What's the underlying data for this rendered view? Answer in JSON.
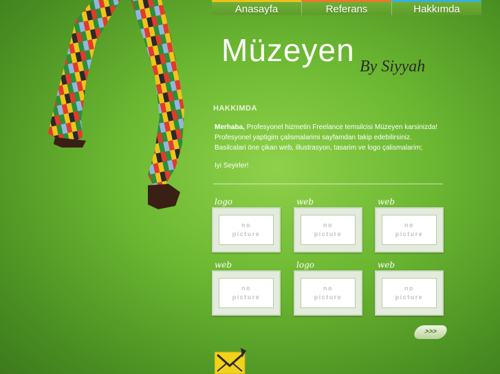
{
  "nav": {
    "items": [
      {
        "label": "Anasayfa",
        "color": "#f0c01a"
      },
      {
        "label": "Referans",
        "color": "#e87a2a"
      },
      {
        "label": "Hakkımda",
        "color": "#3ab0d8"
      }
    ]
  },
  "header": {
    "title": "Müzeyen",
    "byline": "By Siyyah"
  },
  "about": {
    "section_title": "HAKKIMDA",
    "greeting": "Merhaba,",
    "line1": " Profesyonel hizmetin Freelance temsilcisi Müzeyen karsinizda!",
    "line2": "Profesyonel yaptigim çalismalarimi sayfamdan takip edebilirsiniz.",
    "line3": "Basilcalari öne çikan web, illustrasyon, tasarim ve logo çalismalarim;",
    "closing": "Iyi Seyirler!"
  },
  "portfolio": {
    "items": [
      {
        "label": "logo",
        "placeholder_top": "no",
        "placeholder_bottom": "picture"
      },
      {
        "label": "web",
        "placeholder_top": "no",
        "placeholder_bottom": "picture"
      },
      {
        "label": "web",
        "placeholder_top": "no",
        "placeholder_bottom": "picture"
      },
      {
        "label": "web",
        "placeholder_top": "no",
        "placeholder_bottom": "picture"
      },
      {
        "label": "logo",
        "placeholder_top": "no",
        "placeholder_bottom": "picture"
      },
      {
        "label": "web",
        "placeholder_top": "no",
        "placeholder_bottom": "picture"
      }
    ],
    "more_label": ">>>"
  },
  "icons": {
    "mail": "mail-icon",
    "legs": "striped-stockings-illustration"
  }
}
